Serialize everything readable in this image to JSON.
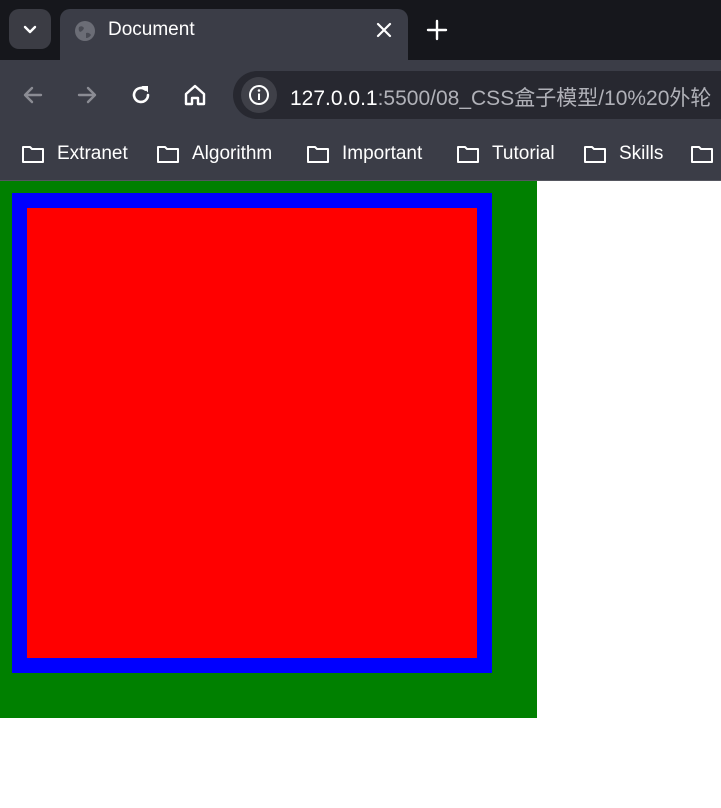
{
  "browser": {
    "tab": {
      "title": "Document"
    },
    "address_bar": {
      "host": "127.0.0.1",
      "path": ":5500/08_CSS盒子模型/10%20外轮"
    },
    "bookmarks": [
      {
        "label": "Extranet"
      },
      {
        "label": "Algorithm"
      },
      {
        "label": "Important"
      },
      {
        "label": "Tutorial"
      },
      {
        "label": "Skills"
      },
      {
        "label": ""
      }
    ]
  },
  "page": {
    "outer_box_color": "#008000",
    "middle_box_color": "#0000ff",
    "inner_box_color": "#ff0000"
  },
  "icons": [
    "chevron-down-icon",
    "globe-icon",
    "close-icon",
    "plus-icon",
    "back-arrow-icon",
    "forward-arrow-icon",
    "reload-icon",
    "home-icon",
    "info-icon",
    "folder-icon"
  ]
}
